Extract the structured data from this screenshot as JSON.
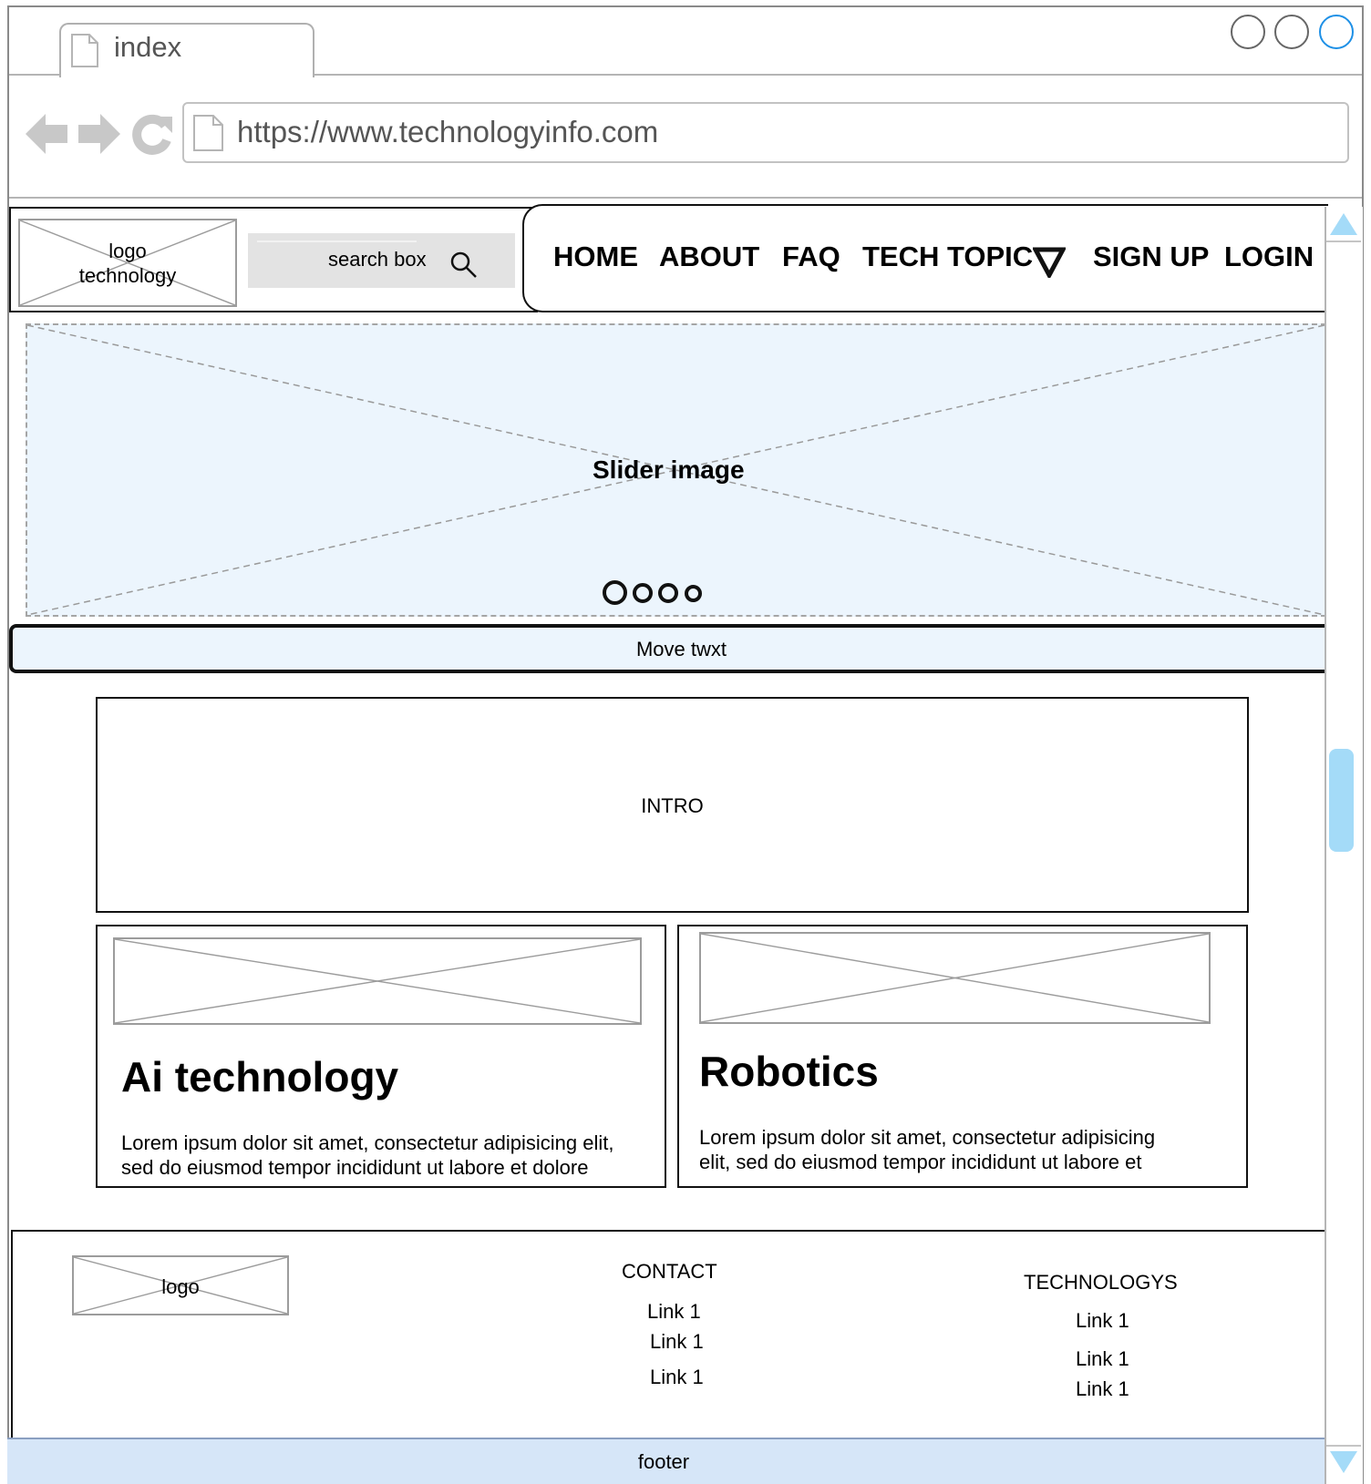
{
  "browser": {
    "tab_title": "index",
    "url": "https://www.technologyinfo.com",
    "colors": {
      "chrome_gray": "#b5b5b5",
      "icon_gray": "#c8c8c8",
      "active_window_button": "#1e90e6"
    }
  },
  "header": {
    "logo_text": "logo\ntechnology",
    "search_text": "search box",
    "nav": [
      "HOME",
      "ABOUT",
      "FAQ",
      "TECH TOPIC",
      "SIGN UP",
      "LOGIN"
    ]
  },
  "slider": {
    "label": "Slider image",
    "dots_count": 4,
    "background": "#ecf5fd"
  },
  "marquee": {
    "text": "Move twxt"
  },
  "intro": {
    "text": "INTRO"
  },
  "cards": [
    {
      "title": "Ai technology",
      "body": "Lorem ipsum dolor sit amet, consectetur adipisicing elit,\nsed do eiusmod tempor incididunt ut labore et dolore"
    },
    {
      "title": "Robotics",
      "body": "Lorem ipsum dolor sit amet, consectetur adipisicing\nelit, sed do eiusmod tempor incididunt ut labore et"
    }
  ],
  "footer": {
    "logo_text": "logo",
    "contact_heading": "CONTACT",
    "contact_links": [
      "Link 1",
      "Link 1",
      "Link 1"
    ],
    "tech_heading": "TECHNOLOGYS",
    "tech_links": [
      "Link 1",
      "Link 1",
      "Link 1"
    ],
    "bar_text": "footer",
    "bar_color": "#d6e6f8"
  },
  "scrollbar": {
    "thumb_color": "#a4dbf8"
  }
}
